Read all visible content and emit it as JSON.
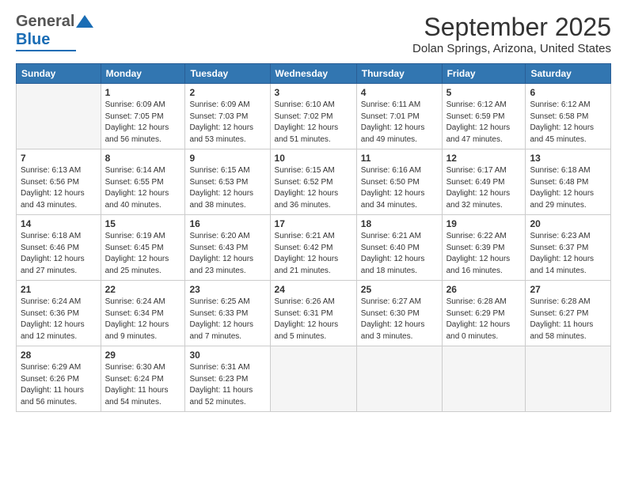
{
  "header": {
    "logo_general": "General",
    "logo_blue": "Blue",
    "month_title": "September 2025",
    "location": "Dolan Springs, Arizona, United States"
  },
  "days_of_week": [
    "Sunday",
    "Monday",
    "Tuesday",
    "Wednesday",
    "Thursday",
    "Friday",
    "Saturday"
  ],
  "weeks": [
    [
      {
        "num": "",
        "empty": true
      },
      {
        "num": "1",
        "sunrise": "6:09 AM",
        "sunset": "7:05 PM",
        "daylight": "12 hours and 56 minutes."
      },
      {
        "num": "2",
        "sunrise": "6:09 AM",
        "sunset": "7:03 PM",
        "daylight": "12 hours and 53 minutes."
      },
      {
        "num": "3",
        "sunrise": "6:10 AM",
        "sunset": "7:02 PM",
        "daylight": "12 hours and 51 minutes."
      },
      {
        "num": "4",
        "sunrise": "6:11 AM",
        "sunset": "7:01 PM",
        "daylight": "12 hours and 49 minutes."
      },
      {
        "num": "5",
        "sunrise": "6:12 AM",
        "sunset": "6:59 PM",
        "daylight": "12 hours and 47 minutes."
      },
      {
        "num": "6",
        "sunrise": "6:12 AM",
        "sunset": "6:58 PM",
        "daylight": "12 hours and 45 minutes."
      }
    ],
    [
      {
        "num": "7",
        "sunrise": "6:13 AM",
        "sunset": "6:56 PM",
        "daylight": "12 hours and 43 minutes."
      },
      {
        "num": "8",
        "sunrise": "6:14 AM",
        "sunset": "6:55 PM",
        "daylight": "12 hours and 40 minutes."
      },
      {
        "num": "9",
        "sunrise": "6:15 AM",
        "sunset": "6:53 PM",
        "daylight": "12 hours and 38 minutes."
      },
      {
        "num": "10",
        "sunrise": "6:15 AM",
        "sunset": "6:52 PM",
        "daylight": "12 hours and 36 minutes."
      },
      {
        "num": "11",
        "sunrise": "6:16 AM",
        "sunset": "6:50 PM",
        "daylight": "12 hours and 34 minutes."
      },
      {
        "num": "12",
        "sunrise": "6:17 AM",
        "sunset": "6:49 PM",
        "daylight": "12 hours and 32 minutes."
      },
      {
        "num": "13",
        "sunrise": "6:18 AM",
        "sunset": "6:48 PM",
        "daylight": "12 hours and 29 minutes."
      }
    ],
    [
      {
        "num": "14",
        "sunrise": "6:18 AM",
        "sunset": "6:46 PM",
        "daylight": "12 hours and 27 minutes."
      },
      {
        "num": "15",
        "sunrise": "6:19 AM",
        "sunset": "6:45 PM",
        "daylight": "12 hours and 25 minutes."
      },
      {
        "num": "16",
        "sunrise": "6:20 AM",
        "sunset": "6:43 PM",
        "daylight": "12 hours and 23 minutes."
      },
      {
        "num": "17",
        "sunrise": "6:21 AM",
        "sunset": "6:42 PM",
        "daylight": "12 hours and 21 minutes."
      },
      {
        "num": "18",
        "sunrise": "6:21 AM",
        "sunset": "6:40 PM",
        "daylight": "12 hours and 18 minutes."
      },
      {
        "num": "19",
        "sunrise": "6:22 AM",
        "sunset": "6:39 PM",
        "daylight": "12 hours and 16 minutes."
      },
      {
        "num": "20",
        "sunrise": "6:23 AM",
        "sunset": "6:37 PM",
        "daylight": "12 hours and 14 minutes."
      }
    ],
    [
      {
        "num": "21",
        "sunrise": "6:24 AM",
        "sunset": "6:36 PM",
        "daylight": "12 hours and 12 minutes."
      },
      {
        "num": "22",
        "sunrise": "6:24 AM",
        "sunset": "6:34 PM",
        "daylight": "12 hours and 9 minutes."
      },
      {
        "num": "23",
        "sunrise": "6:25 AM",
        "sunset": "6:33 PM",
        "daylight": "12 hours and 7 minutes."
      },
      {
        "num": "24",
        "sunrise": "6:26 AM",
        "sunset": "6:31 PM",
        "daylight": "12 hours and 5 minutes."
      },
      {
        "num": "25",
        "sunrise": "6:27 AM",
        "sunset": "6:30 PM",
        "daylight": "12 hours and 3 minutes."
      },
      {
        "num": "26",
        "sunrise": "6:28 AM",
        "sunset": "6:29 PM",
        "daylight": "12 hours and 0 minutes."
      },
      {
        "num": "27",
        "sunrise": "6:28 AM",
        "sunset": "6:27 PM",
        "daylight": "11 hours and 58 minutes."
      }
    ],
    [
      {
        "num": "28",
        "sunrise": "6:29 AM",
        "sunset": "6:26 PM",
        "daylight": "11 hours and 56 minutes."
      },
      {
        "num": "29",
        "sunrise": "6:30 AM",
        "sunset": "6:24 PM",
        "daylight": "11 hours and 54 minutes."
      },
      {
        "num": "30",
        "sunrise": "6:31 AM",
        "sunset": "6:23 PM",
        "daylight": "11 hours and 52 minutes."
      },
      {
        "num": "",
        "empty": true
      },
      {
        "num": "",
        "empty": true
      },
      {
        "num": "",
        "empty": true
      },
      {
        "num": "",
        "empty": true
      }
    ]
  ],
  "labels": {
    "sunrise": "Sunrise:",
    "sunset": "Sunset:",
    "daylight": "Daylight:"
  }
}
